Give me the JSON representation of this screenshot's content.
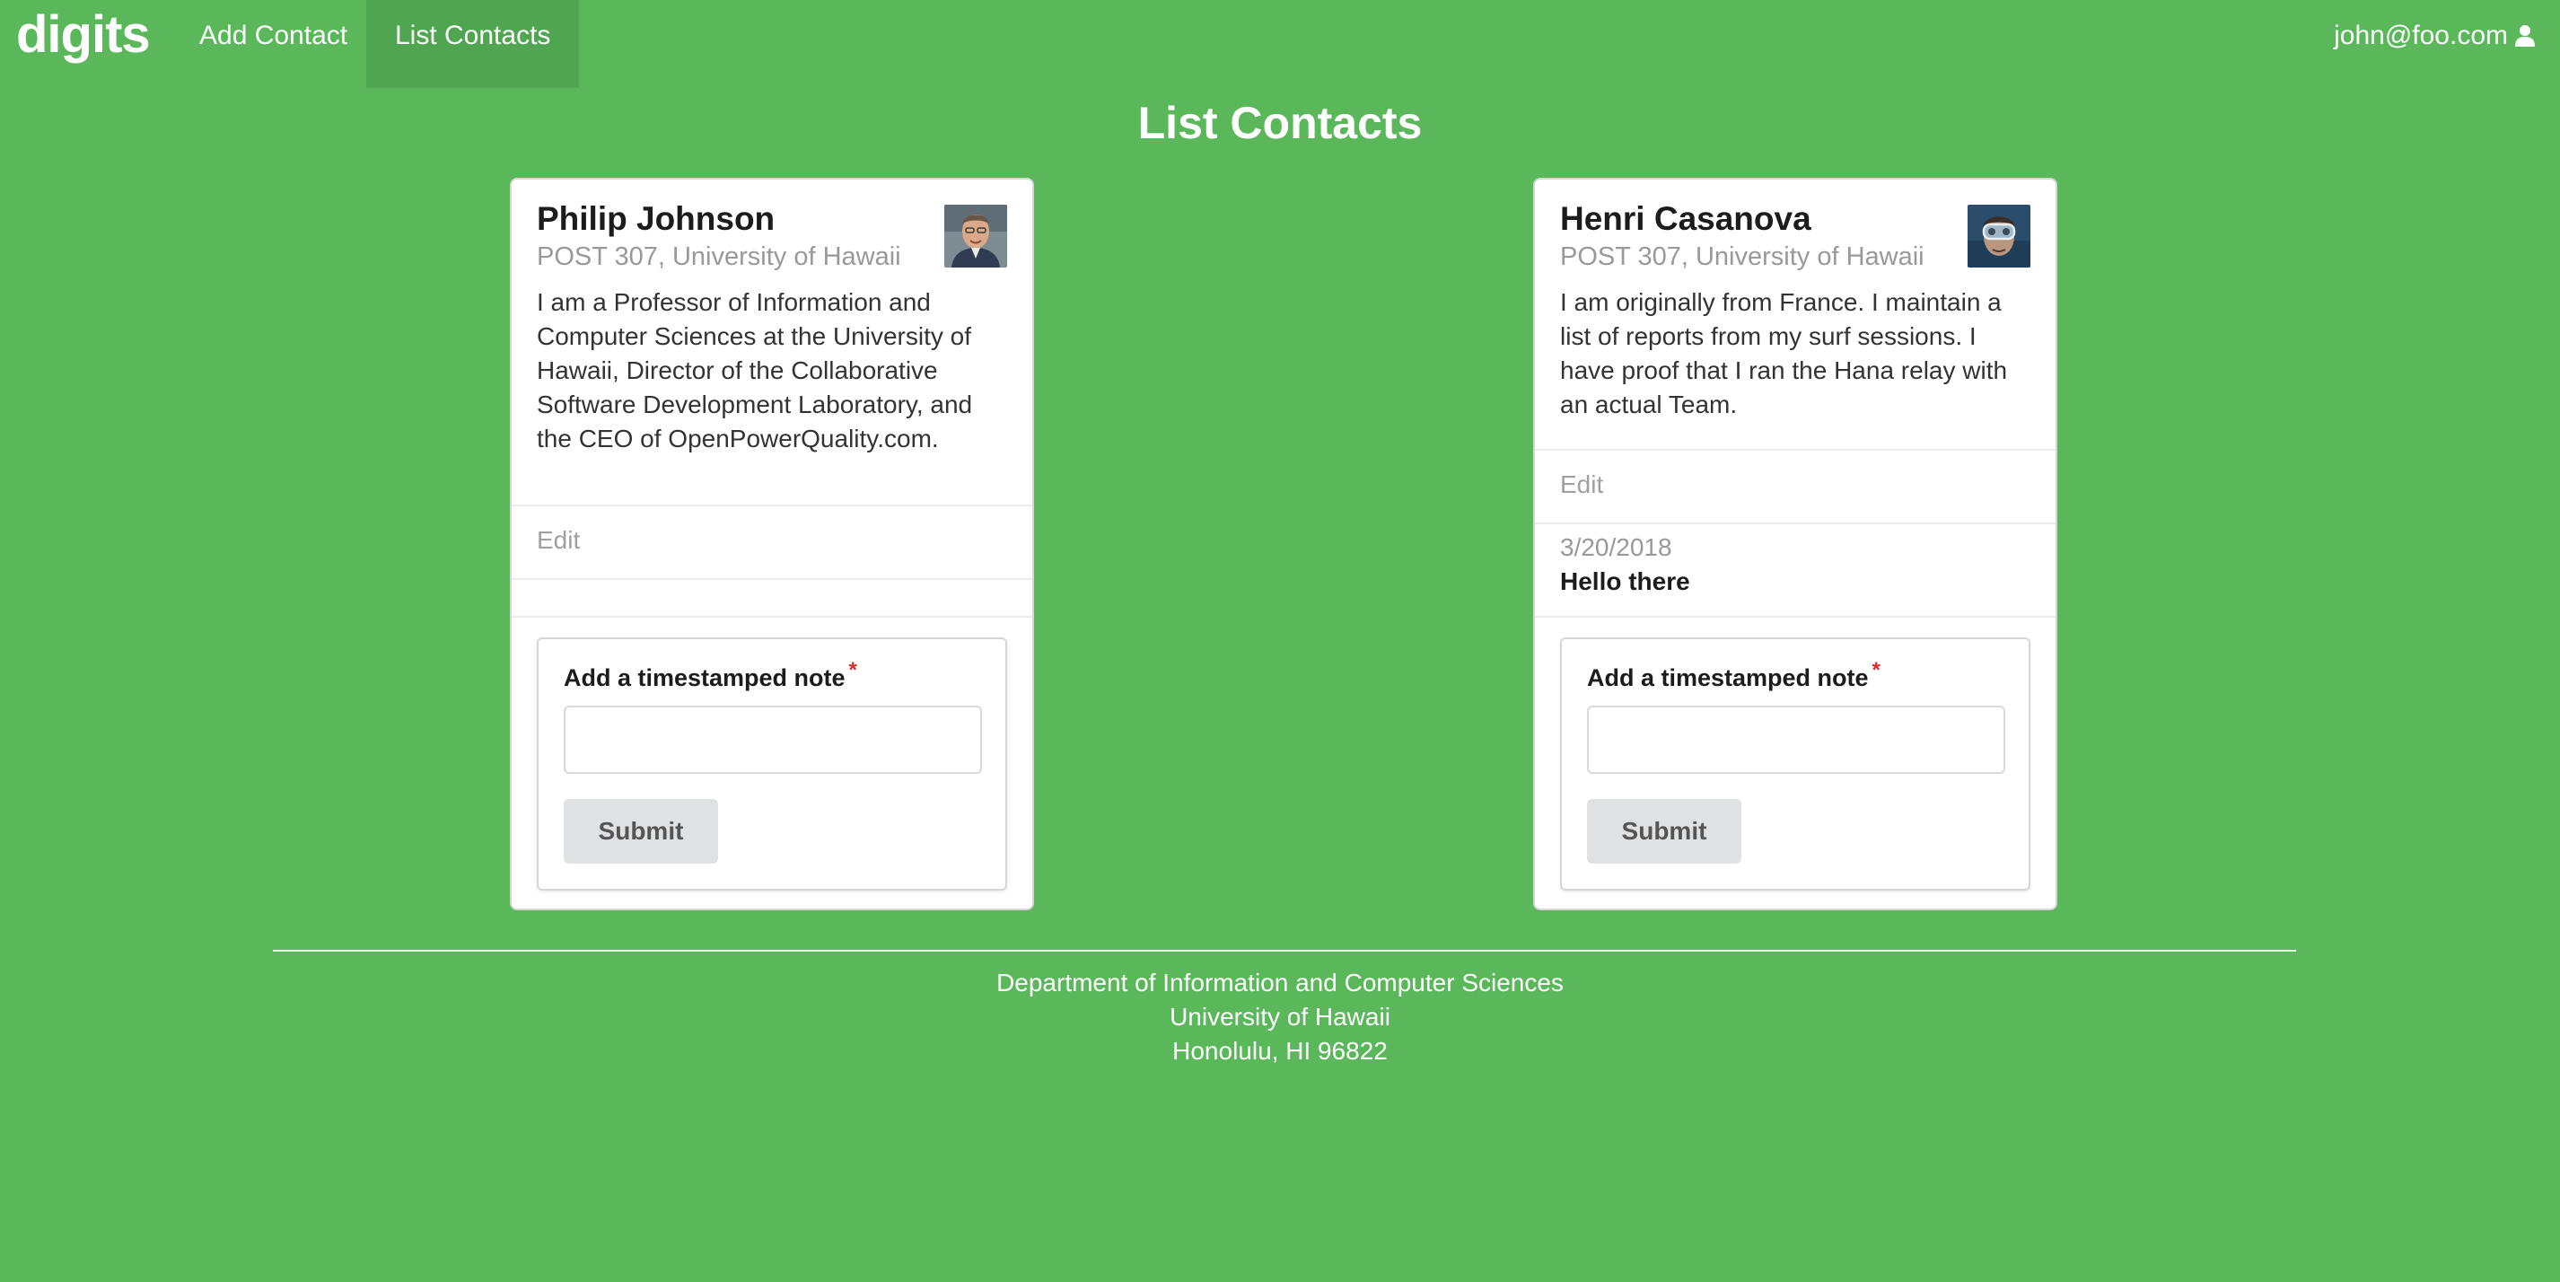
{
  "navbar": {
    "brand": "digits",
    "items": [
      {
        "label": "Add Contact",
        "active": false
      },
      {
        "label": "List Contacts",
        "active": true
      }
    ],
    "user_email": "john@foo.com",
    "user_icon": "user-icon"
  },
  "page": {
    "title": "List Contacts"
  },
  "contacts": [
    {
      "name": "Philip Johnson",
      "address": "POST 307, University of Hawaii",
      "description": "I am a Professor of Information and Computer Sciences at the University of Hawaii, Director of the Collaborative Software Development Laboratory, and the CEO of OpenPowerQuality.com.",
      "edit_label": "Edit",
      "notes": [],
      "form": {
        "label": "Add a timestamped note",
        "required_mark": "*",
        "input_value": "",
        "submit_label": "Submit"
      }
    },
    {
      "name": "Henri Casanova",
      "address": "POST 307, University of Hawaii",
      "description": "I am originally from France. I maintain a list of reports from my surf sessions. I have proof that I ran the Hana relay with an actual Team.",
      "edit_label": "Edit",
      "notes": [
        {
          "date": "3/20/2018",
          "text": "Hello there"
        }
      ],
      "form": {
        "label": "Add a timestamped note",
        "required_mark": "*",
        "input_value": "",
        "submit_label": "Submit"
      }
    }
  ],
  "footer": {
    "line1": "Department of Information and Computer Sciences",
    "line2": "University of Hawaii",
    "line3": "Honolulu, HI 96822"
  },
  "colors": {
    "background": "#5ab85b",
    "active_nav": "#4fa550",
    "required": "#db2828"
  }
}
